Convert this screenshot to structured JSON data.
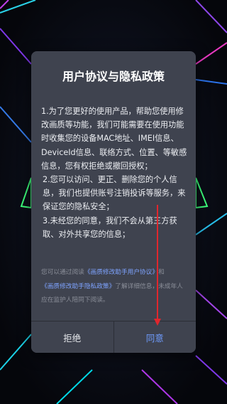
{
  "dialog": {
    "title": "用户协议与隐私政策",
    "paragraph1": "1.为了您更好的使用产品，帮助您使用修改画质等功能，我们可能需要在使用功能时收集您的设备MAC地址、IMEI信息、DeviceId信息、联络方式、位置、等敏感信息，您有权拒绝或撤回授权；",
    "paragraph2": " 2.您可以访问、更正、删除您的个人信息，我们也提供账号注销投诉等服务，来保证您的隐私安全；",
    "paragraph3": " 3.未经您的同意，我们不会从第三方获取、对外共享您的信息；",
    "notice": {
      "prefix": "您可以通过阅读",
      "user_agreement": "《画质修改助手用户协议》",
      "and": "和",
      "privacy_policy": "《画质修改助手隐私政策》",
      "suffix": "了解详细信息，未成年人应在监护人陪同下阅读。"
    },
    "reject_label": "拒绝",
    "agree_label": "同意"
  },
  "colors": {
    "dialog_bg": "#3f434f",
    "link": "#7ea3ff",
    "agree": "#6f9dff",
    "arrow": "#e0262d"
  }
}
